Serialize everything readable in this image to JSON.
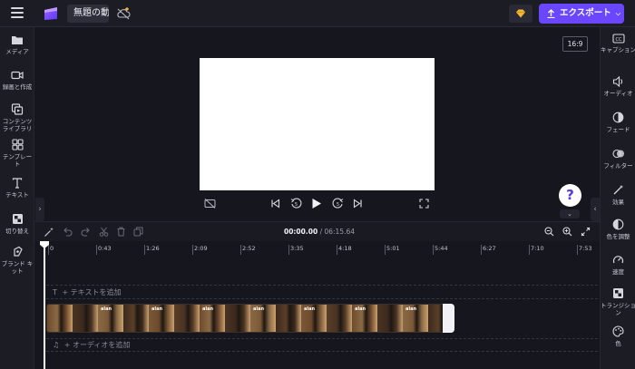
{
  "header": {
    "project_title": "無題の動画",
    "export_label": "エクスポート",
    "colors": {
      "export": "#6a46ff",
      "gem": "#f2b632"
    }
  },
  "left_sidebar": {
    "items": [
      {
        "label": "メディア",
        "icon": "folder-icon"
      },
      {
        "label": "録画と作成",
        "icon": "camera-icon"
      },
      {
        "label": "コンテンツ\nライブラリ",
        "icon": "library-icon"
      },
      {
        "label": "テンプレート",
        "icon": "template-grid-icon"
      },
      {
        "label": "テキスト",
        "icon": "text-icon"
      },
      {
        "label": "切り替え",
        "icon": "transition-icon"
      },
      {
        "label": "ブランド キット",
        "icon": "brand-kit-icon"
      }
    ]
  },
  "right_sidebar": {
    "items": [
      {
        "label": "キャプション",
        "icon": "captions-icon"
      },
      {
        "label": "オーディオ",
        "icon": "speaker-icon"
      },
      {
        "label": "フェード",
        "icon": "fade-icon"
      },
      {
        "label": "フィルター",
        "icon": "filter-icon"
      },
      {
        "label": "効果",
        "icon": "magic-wand-icon"
      },
      {
        "label": "色を調整",
        "icon": "color-adjust-icon"
      },
      {
        "label": "速度",
        "icon": "speed-icon"
      },
      {
        "label": "トランジション",
        "icon": "transition-icon"
      },
      {
        "label": "色",
        "icon": "palette-icon"
      }
    ]
  },
  "preview": {
    "aspect_ratio": "16:9",
    "help": "?"
  },
  "timeline": {
    "current_time": "00:00.00",
    "total_time": "/ 06:15.64",
    "ruler": [
      "0",
      "0:43",
      "1:26",
      "2:09",
      "2:52",
      "3:35",
      "4:18",
      "5:01",
      "5:44",
      "6:27",
      "7:10",
      "7:53"
    ],
    "text_track_label": "+ テキストを追加",
    "audio_track_label": "+ オーディオを追加",
    "clip_caption": "alan"
  }
}
